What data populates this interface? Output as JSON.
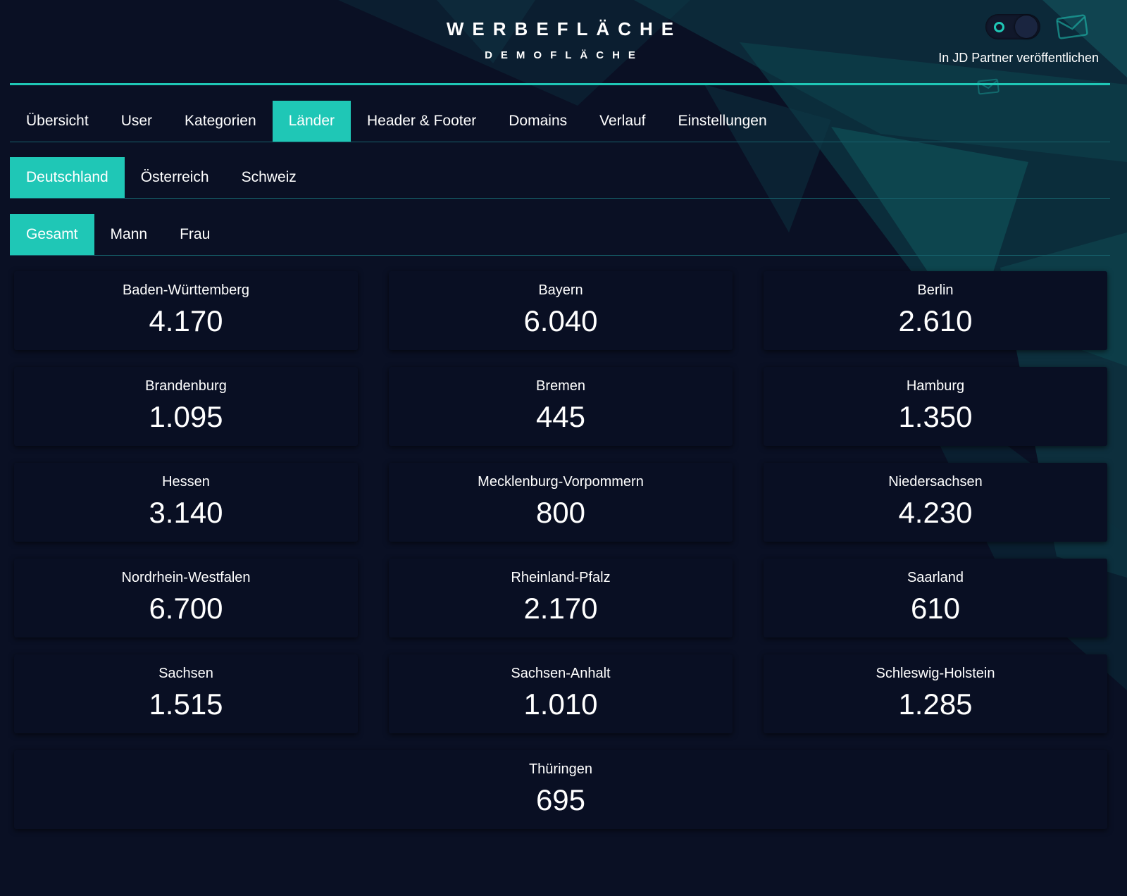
{
  "header": {
    "title": "WERBEFLÄCHE",
    "subtitle": "DEMOFLÄCHE",
    "publish_label": "In JD Partner veröffentlichen",
    "publish_toggle": "off",
    "icons": [
      "toggle",
      "mail-icon"
    ]
  },
  "colors": {
    "accent": "#1fc7b6",
    "background": "#0a1024",
    "card": "#090f23"
  },
  "main_tabs": [
    "Übersicht",
    "User",
    "Kategorien",
    "Länder",
    "Header & Footer",
    "Domains",
    "Verlauf",
    "Einstellungen"
  ],
  "main_tabs_active": "Länder",
  "country_tabs": [
    "Deutschland",
    "Österreich",
    "Schweiz"
  ],
  "country_tabs_active": "Deutschland",
  "gender_tabs": [
    "Gesamt",
    "Mann",
    "Frau"
  ],
  "gender_tabs_active": "Gesamt",
  "states": [
    {
      "name": "Baden-Württemberg",
      "value": "4.170"
    },
    {
      "name": "Bayern",
      "value": "6.040"
    },
    {
      "name": "Berlin",
      "value": "2.610"
    },
    {
      "name": "Brandenburg",
      "value": "1.095"
    },
    {
      "name": "Bremen",
      "value": "445"
    },
    {
      "name": "Hamburg",
      "value": "1.350"
    },
    {
      "name": "Hessen",
      "value": "3.140"
    },
    {
      "name": "Mecklenburg-Vorpommern",
      "value": "800"
    },
    {
      "name": "Niedersachsen",
      "value": "4.230"
    },
    {
      "name": "Nordrhein-Westfalen",
      "value": "6.700"
    },
    {
      "name": "Rheinland-Pfalz",
      "value": "2.170"
    },
    {
      "name": "Saarland",
      "value": "610"
    },
    {
      "name": "Sachsen",
      "value": "1.515"
    },
    {
      "name": "Sachsen-Anhalt",
      "value": "1.010"
    },
    {
      "name": "Schleswig-Holstein",
      "value": "1.285"
    },
    {
      "name": "Thüringen",
      "value": "695"
    }
  ]
}
